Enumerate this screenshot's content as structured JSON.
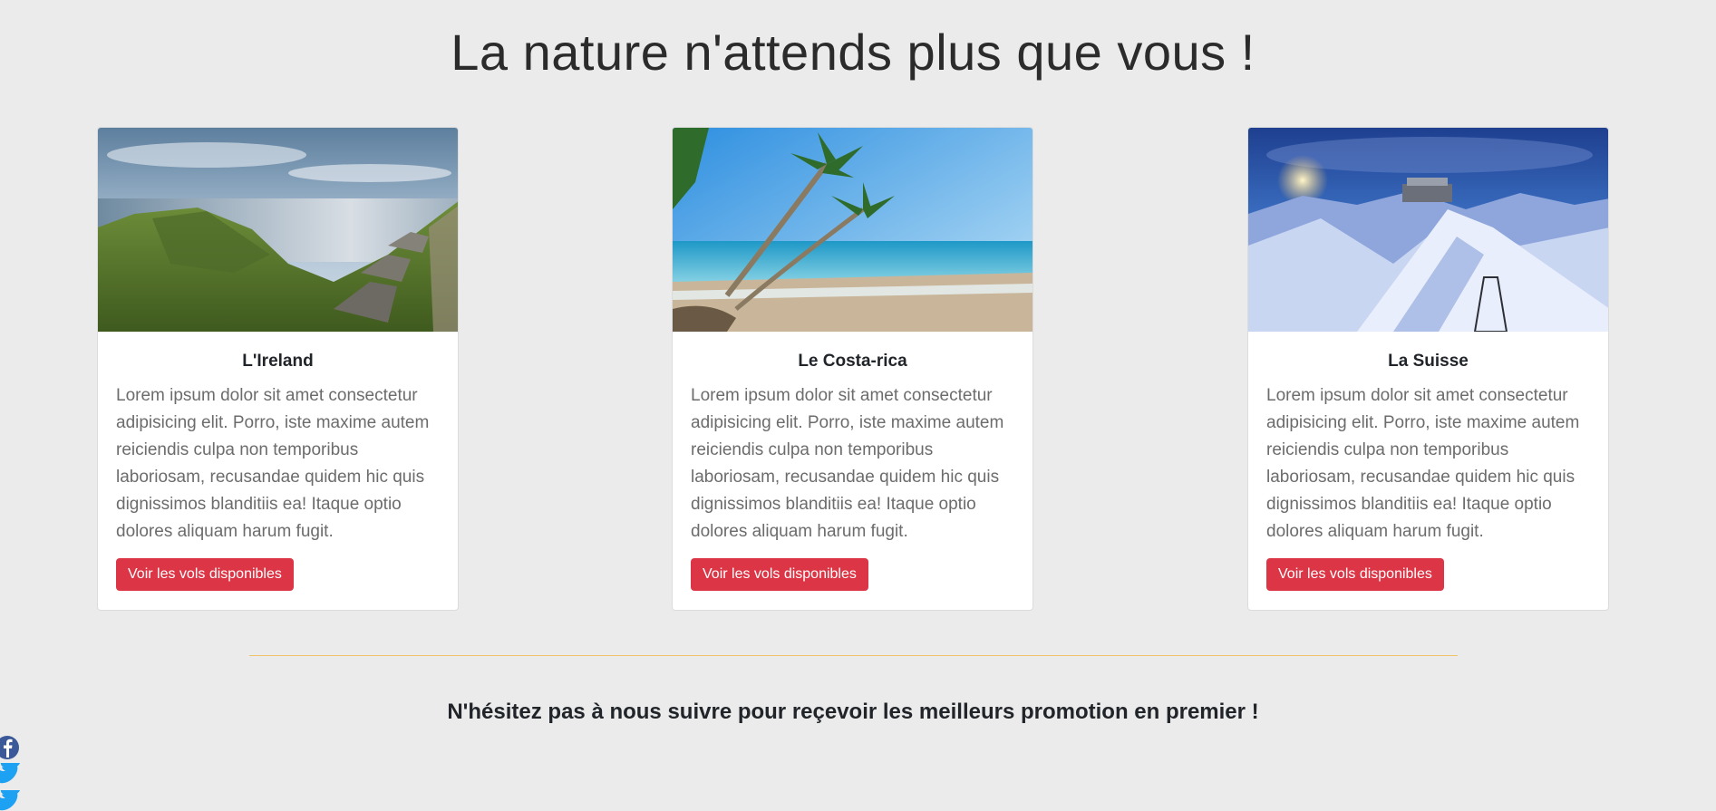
{
  "header": {
    "title": "La nature n'attends plus que vous !"
  },
  "cards": [
    {
      "title": "L'Ireland",
      "text": "Lorem ipsum dolor sit amet consectetur adipisicing elit. Porro, iste maxime autem reiciendis culpa non temporibus laboriosam, recusandae quidem hic quis dignissimos blanditiis ea! Itaque optio dolores aliquam harum fugit.",
      "button": "Voir les vols disponibles"
    },
    {
      "title": "Le Costa-rica",
      "text": "Lorem ipsum dolor sit amet consectetur adipisicing elit. Porro, iste maxime autem reiciendis culpa non temporibus laboriosam, recusandae quidem hic quis dignissimos blanditiis ea! Itaque optio dolores aliquam harum fugit.",
      "button": "Voir les vols disponibles"
    },
    {
      "title": "La Suisse",
      "text": "Lorem ipsum dolor sit amet consectetur adipisicing elit. Porro, iste maxime autem reiciendis culpa non temporibus laboriosam, recusandae quidem hic quis dignissimos blanditiis ea! Itaque optio dolores aliquam harum fugit.",
      "button": "Voir les vols disponibles"
    }
  ],
  "follow": {
    "text": "N'hésitez pas à nous suivre pour reçevoir les meilleurs promotion en premier !"
  },
  "social": {
    "icons": [
      "facebook-icon",
      "twitter-icon",
      "twitter-icon"
    ]
  },
  "colors": {
    "background": "#ebebeb",
    "button": "#dc3545",
    "divider": "#f0c36b",
    "facebook": "#3b5998",
    "twitter": "#1da1f2"
  }
}
